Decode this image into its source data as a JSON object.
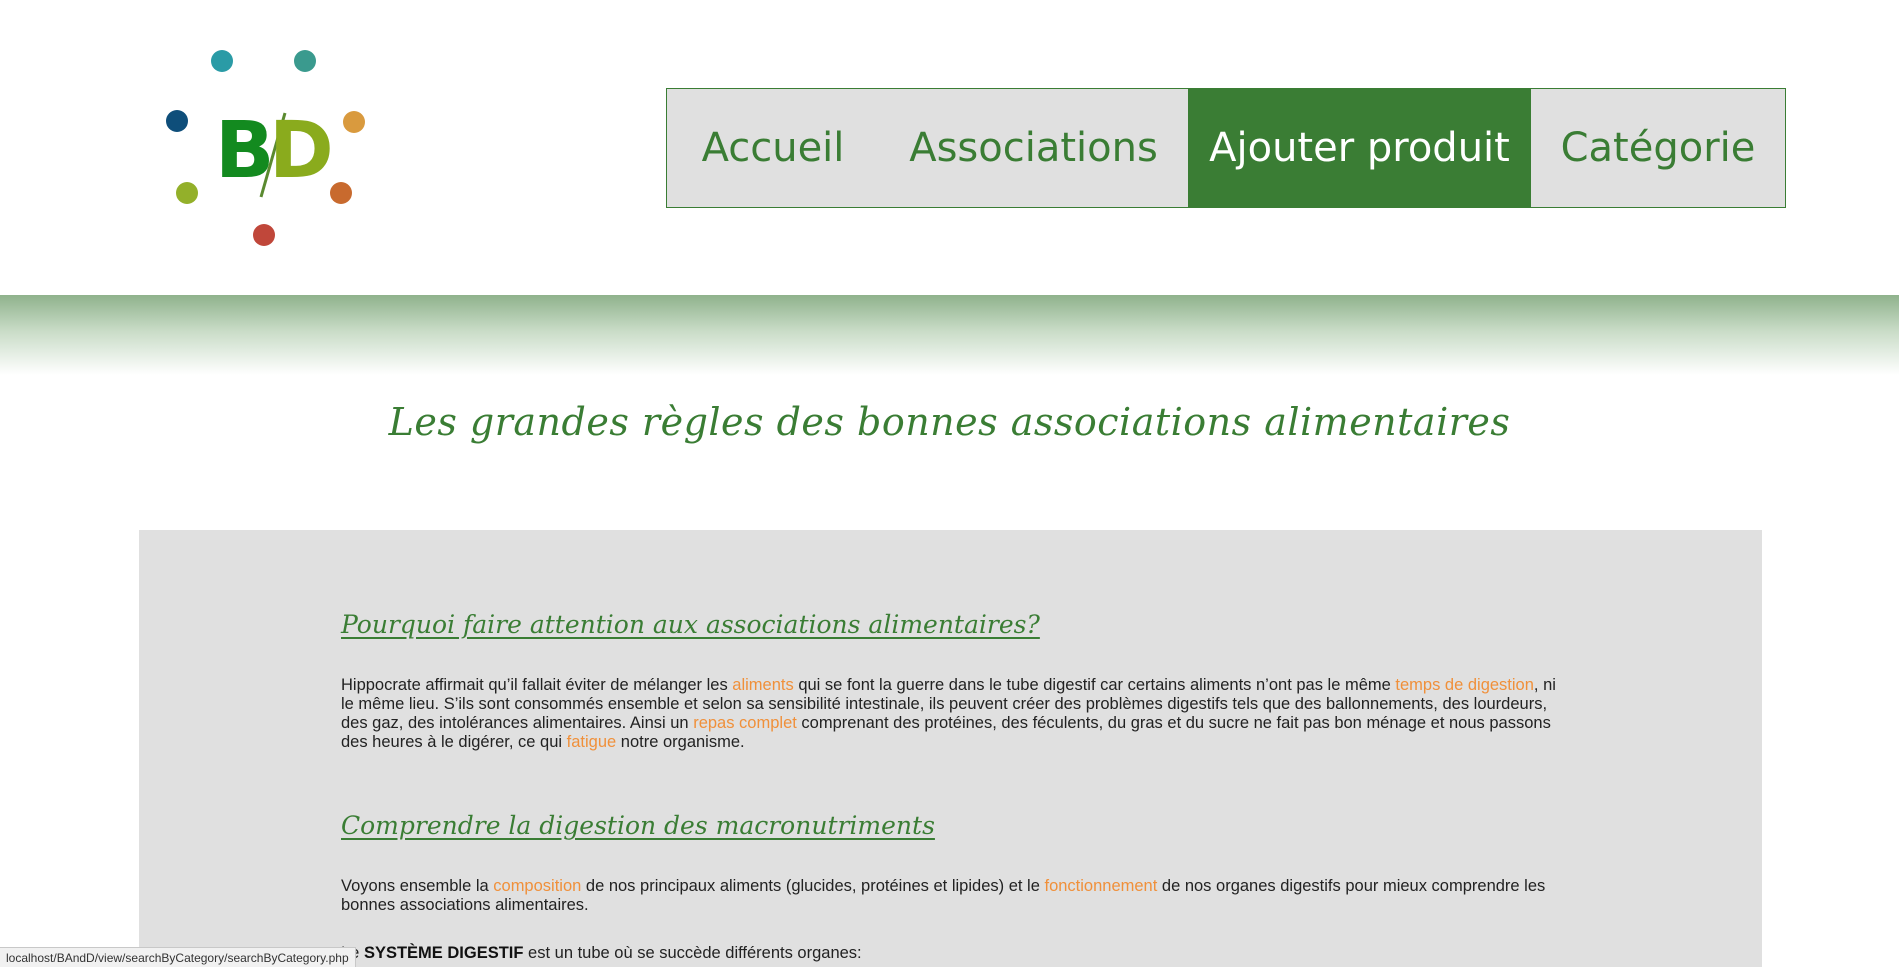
{
  "logo": {
    "letter_b": "B",
    "letter_d": "D",
    "dot_colors": [
      "#2a9ba6",
      "#3a9a8e",
      "#d99a3e",
      "#c86a2e",
      "#c0473a",
      "#93b02a",
      "#0e4e7a"
    ],
    "b_color": "#138a1f",
    "d_color": "#8aab1d"
  },
  "nav": {
    "items": [
      {
        "label": "Accueil",
        "active": false
      },
      {
        "label": "Associations",
        "active": false
      },
      {
        "label": "Ajouter produit",
        "active": true
      },
      {
        "label": "Catégorie",
        "active": false
      }
    ]
  },
  "main_title": "Les grandes règles des bonnes associations alimentaires",
  "sections": [
    {
      "title": "Pourquoi faire attention aux associations alimentaires?",
      "paragraph": {
        "p1": "Hippocrate affirmait qu’il fallait éviter de mélanger les ",
        "link1": "aliments",
        "p2": " qui se font la guerre dans le tube digestif car certains aliments n’ont pas le même ",
        "link2": "temps de digestion",
        "p3": ", ni le même lieu. S’ils sont consommés ensemble et selon sa sensibilité intestinale, ils peuvent créer des problèmes digestifs tels que des ballonnements, des lourdeurs, des gaz, des intolérances alimentaires. Ainsi un ",
        "link3": "repas complet",
        "p4": " comprenant des protéines, des féculents, du gras et du sucre ne fait pas bon ménage et nous passons des heures à le digérer, ce qui ",
        "link4": "fatigue",
        "p5": " notre organisme."
      }
    },
    {
      "title": "Comprendre la digestion des macronutriments",
      "paragraph": {
        "p1": "Voyons ensemble la ",
        "link1": "composition",
        "p2": " de nos principaux aliments (glucides, protéines et lipides) et le ",
        "link2": "fonctionnement",
        "p3": " de nos organes digestifs pour mieux comprendre les bonnes associations alimentaires."
      }
    }
  ],
  "digestive": {
    "prefix": "Le ",
    "bold": "SYSTÈME DIGESTIF",
    "suffix": " est un tube où se succède différents organes:"
  },
  "colors": {
    "brand_green": "#3a7d34",
    "link_orange": "#f0903a",
    "card_grey": "#e0e0e0"
  },
  "statusbar": {
    "url": "localhost/BAndD/view/searchByCategory/searchByCategory.php"
  }
}
